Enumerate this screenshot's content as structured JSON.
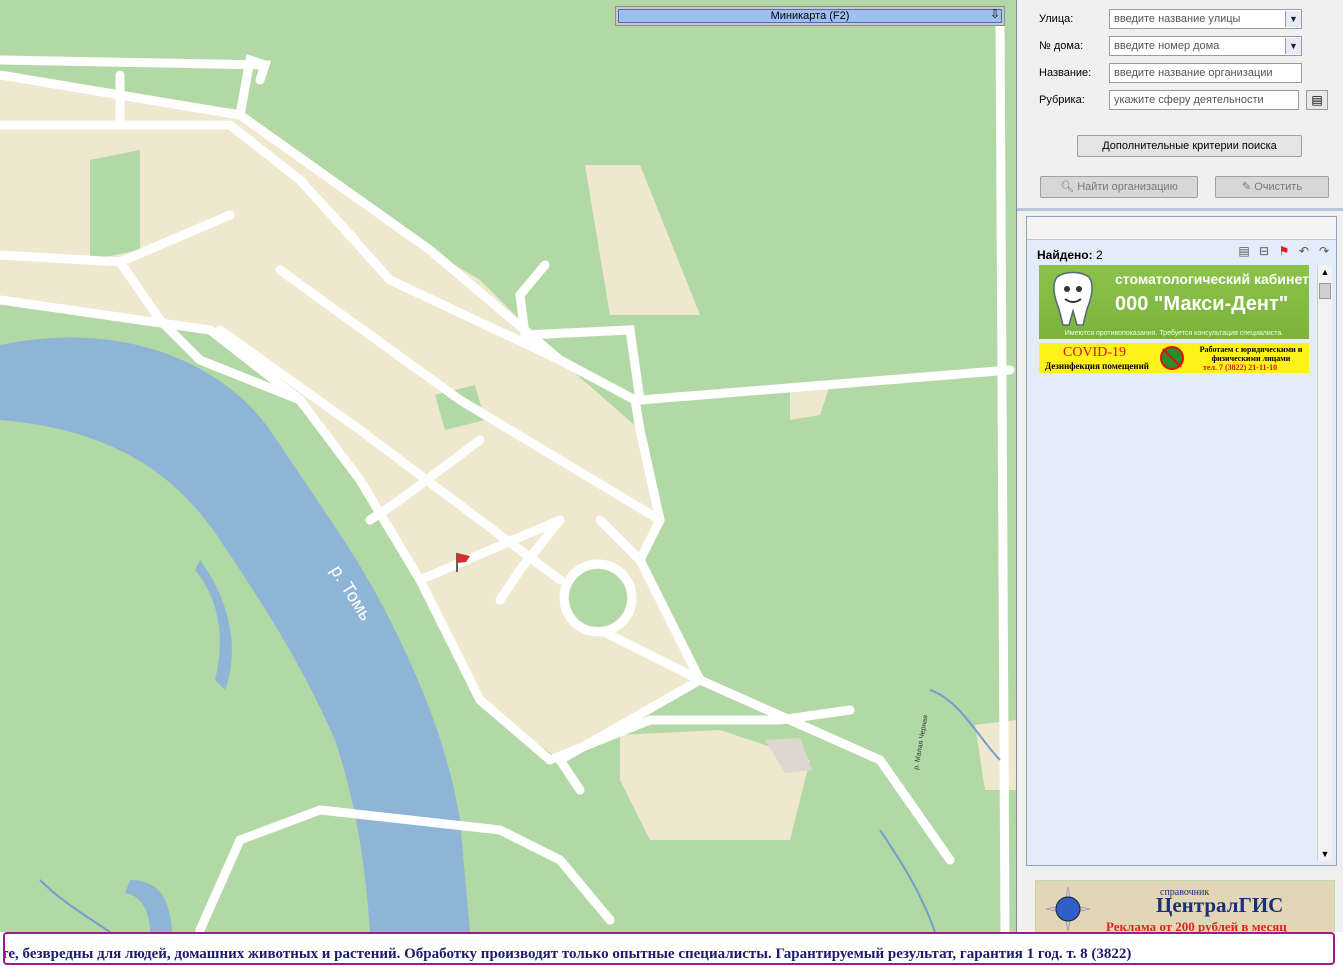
{
  "map": {
    "minimap_label": "Миникарта (F2)",
    "river_label": "р. Томь",
    "street_label": "р. Малая Черная",
    "colors": {
      "land": "#b2d9a5",
      "urban": "#efe8cf",
      "road": "#ffffff",
      "water": "#8fb5d6"
    }
  },
  "search": {
    "street_label": "Улица:",
    "street_placeholder": "введите название улицы",
    "house_label": "№ дома:",
    "house_placeholder": "введите номер дома",
    "name_label": "Название:",
    "name_placeholder": "введите название организации",
    "rubric_label": "Рубрика:",
    "rubric_placeholder": "укажите сферу деятельности",
    "extra_button": "Дополнительные критерии поиска",
    "find_button": "Найти организацию",
    "clear_button": "Очистить"
  },
  "results": {
    "found_label": "Найдено:",
    "found_count": "2"
  },
  "ads": {
    "dent_line1": "стоматологический кабинет",
    "dent_line2": "000 \"Макси-Дент\"",
    "dent_note": "Имеются противопоказания. Требуется консультация специалиста.",
    "covid_title": "COVID-19",
    "covid_sub": "Дезинфекция помещений",
    "covid_right": "Работаем с юридическими и физическими лицами",
    "covid_phone": "тел. 7 (3822) 21-11-10"
  },
  "logo": {
    "small": "справочник",
    "name": "ЦентралГИС",
    "promo": "Реклама от 200 рублей в месяц"
  },
  "ticker": {
    "text": "те, безвредны для людей, домашних животных и растений. Обработку производят только опытные специалисты. Гарантируемый результат, гарантия 1 год.  т. 8 (3822)"
  }
}
